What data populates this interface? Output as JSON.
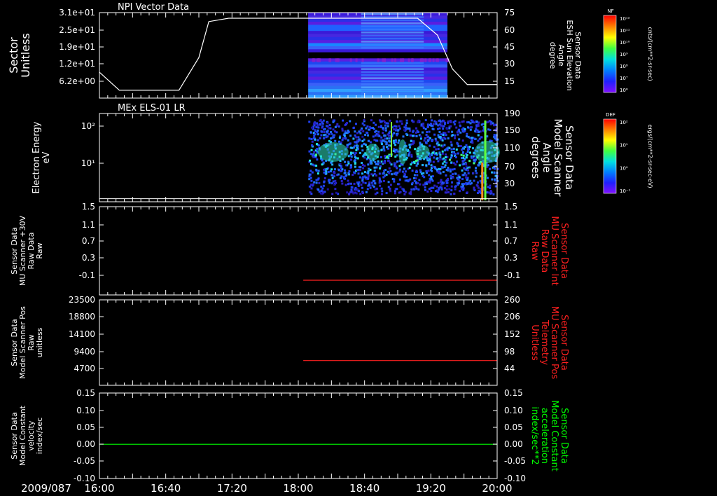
{
  "colors": {
    "background": "#000000",
    "axis": "#ffffff",
    "red": "#ff2020",
    "green": "#00ff00"
  },
  "date_label": "2009/087",
  "x_axis": {
    "ticks": [
      "16:00",
      "16:40",
      "17:20",
      "18:00",
      "18:40",
      "19:20",
      "20:00"
    ],
    "range_hours": [
      16,
      20
    ]
  },
  "panels": [
    {
      "id": "npi",
      "title": "NPI Vector Data",
      "left_label": [
        "Sector",
        "Unitless"
      ],
      "left_ticks": [
        "3.1e+01",
        "2.5e+01",
        "1.9e+01",
        "1.2e+01",
        "6.2e+00"
      ],
      "right_label": [
        "Sensor Data",
        "ESH Sun Elevation",
        "Angle",
        "degree"
      ],
      "right_ticks": [
        "75",
        "60",
        "45",
        "30",
        "15"
      ],
      "colorbar": {
        "title": "NF",
        "unit": "cnts/(cm**2-sr-sec)",
        "ticks": [
          "10¹²",
          "10¹¹",
          "10¹⁰",
          "10⁹",
          "10⁸",
          "10⁷",
          "10⁶"
        ]
      }
    },
    {
      "id": "els",
      "title": "MEx ELS-01 LR",
      "left_label": [
        "Electron Energy",
        "eV"
      ],
      "left_ticks": [
        "10²",
        "10¹"
      ],
      "right_label": [
        "Sensor Data",
        "Model Scanner",
        "Angle",
        "degrees"
      ],
      "right_ticks": [
        "190",
        "150",
        "110",
        "70",
        "30"
      ],
      "colorbar": {
        "title": "DEF",
        "unit": "ergs/(cm**2-sr-sec-eV)",
        "ticks": [
          "10²",
          "10¹",
          "10⁰",
          "10⁻¹"
        ]
      }
    },
    {
      "id": "mu_raw",
      "left_label": [
        "Sensor Data",
        "MU Scanner +30V",
        "Raw Data",
        "Raw"
      ],
      "left_ticks": [
        "1.5",
        "1.1",
        "0.7",
        "0.3",
        "-0.1"
      ],
      "right_label": [
        "Sensor Data",
        "MU Scanner Int",
        "Raw Data",
        "Raw"
      ],
      "right_ticks": [
        "1.5",
        "1.1",
        "0.7",
        "0.3",
        "-0.1"
      ]
    },
    {
      "id": "mu_pos",
      "left_label": [
        "Sensor Data",
        "Model Scanner Pos",
        "Raw",
        "unitless"
      ],
      "left_ticks": [
        "23500",
        "18800",
        "14100",
        "9400",
        "4700"
      ],
      "right_label": [
        "Sensor Data",
        "MU Scanner Pos",
        "Telemetry",
        "Unitless"
      ],
      "right_ticks": [
        "260",
        "206",
        "152",
        "98",
        "44"
      ]
    },
    {
      "id": "model_const",
      "left_label": [
        "Sensor Data",
        "Model Constant",
        "velocity",
        "index/sec"
      ],
      "left_ticks": [
        "0.15",
        "0.10",
        "0.05",
        "0.00",
        "-0.05",
        "-0.10"
      ],
      "right_label": [
        "Sensor Data",
        "Model Constant",
        "acceleration",
        "index/sec**2"
      ],
      "right_ticks": [
        "0.15",
        "0.10",
        "0.05",
        "0.00",
        "-0.05",
        "-0.10"
      ]
    }
  ],
  "chart_data": [
    {
      "type": "heatmap",
      "title": "NPI Vector Data",
      "ylabel": "Sector Unitless",
      "y2label": "Sensor Data ESH Sun Elevation Angle degree",
      "line_series": {
        "name": "ESH Sun Elevation Angle",
        "x_hours": [
          16.0,
          16.2,
          16.4,
          16.6,
          16.8,
          17.0,
          17.1,
          17.3,
          17.5,
          19.2,
          19.4,
          19.55,
          19.7,
          20.0
        ],
        "values": [
          27,
          11,
          11,
          11,
          11,
          40,
          72,
          75,
          75,
          75,
          60,
          30,
          16,
          16
        ]
      },
      "spectrogram_extent_hours": [
        18.1,
        19.5
      ]
    },
    {
      "type": "heatmap",
      "title": "MEx ELS-01 LR",
      "ylabel": "Electron Energy eV",
      "y2label": "Sensor Data Model Scanner Angle degrees",
      "line_series": {
        "name": "Model Scanner Angle",
        "x_hours": [
          16.0,
          20.0
        ],
        "values": [
          7,
          7
        ]
      },
      "spectrogram_extent_hours": [
        18.1,
        20.0
      ]
    },
    {
      "type": "line",
      "ylabel": "Sensor Data MU Scanner +30V Raw Data Raw",
      "y2label": "Sensor Data MU Scanner Int Raw Data Raw",
      "ylim": [
        -0.3,
        1.5
      ],
      "series": [
        {
          "name": "MU Scanner Int Raw Data",
          "x_hours": [
            18.05,
            20.0
          ],
          "values": [
            0.0,
            0.0
          ]
        }
      ]
    },
    {
      "type": "line",
      "ylabel": "Sensor Data Model Scanner Pos Raw unitless",
      "y2label": "Sensor Data MU Scanner Pos Telemetry Unitless",
      "ylim": [
        18,
        260
      ],
      "series": [
        {
          "name": "MU Scanner Pos Telemetry",
          "x_hours": [
            18.05,
            20.0
          ],
          "values": [
            88,
            88
          ]
        }
      ]
    },
    {
      "type": "line",
      "ylabel": "Sensor Data Model Constant velocity index/sec",
      "y2label": "Sensor Data Model Constant acceleration index/sec**2",
      "ylim": [
        -0.1,
        0.15
      ],
      "series": [
        {
          "name": "Model Constant velocity",
          "x_hours": [
            16.0,
            20.0
          ],
          "values": [
            0.0,
            0.0
          ]
        }
      ]
    }
  ]
}
